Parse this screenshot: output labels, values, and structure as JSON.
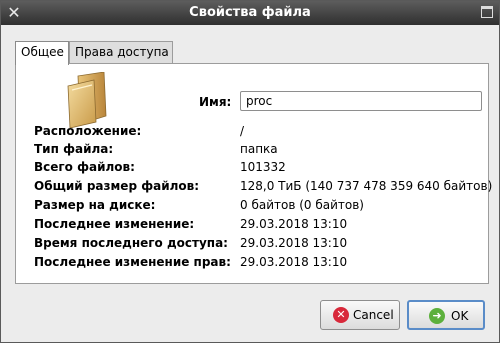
{
  "window": {
    "title": "Свойства файла"
  },
  "tabs": [
    {
      "label": "Общее",
      "active": true
    },
    {
      "label": "Права доступа",
      "active": false
    }
  ],
  "general": {
    "name_label": "Имя:",
    "name_value": "proc",
    "icon": "folder-icon",
    "rows": [
      {
        "label": "Расположение:",
        "value": "/"
      },
      {
        "label": "Тип файла:",
        "value": "папка"
      },
      {
        "label": "Всего файлов:",
        "value": "101332"
      },
      {
        "label": "Общий размер файлов:",
        "value": "128,0 ТиБ (140 737 478 359 640 байтов)"
      },
      {
        "label": "Размер на диске:",
        "value": "0 байтов (0 байтов)"
      },
      {
        "label": "Последнее изменение:",
        "value": "29.03.2018 13:10"
      },
      {
        "label": "Время последнего доступа:",
        "value": "29.03.2018 13:10"
      },
      {
        "label": "Последнее изменение прав:",
        "value": "29.03.2018 13:10"
      }
    ]
  },
  "buttons": {
    "cancel_label": "Cancel",
    "ok_label": "OK"
  },
  "colors": {
    "titlebar": "#3a3a3a",
    "cancel_icon": "#d8283a",
    "ok_icon": "#5cb03c",
    "ok_border": "#5a8cc8"
  }
}
